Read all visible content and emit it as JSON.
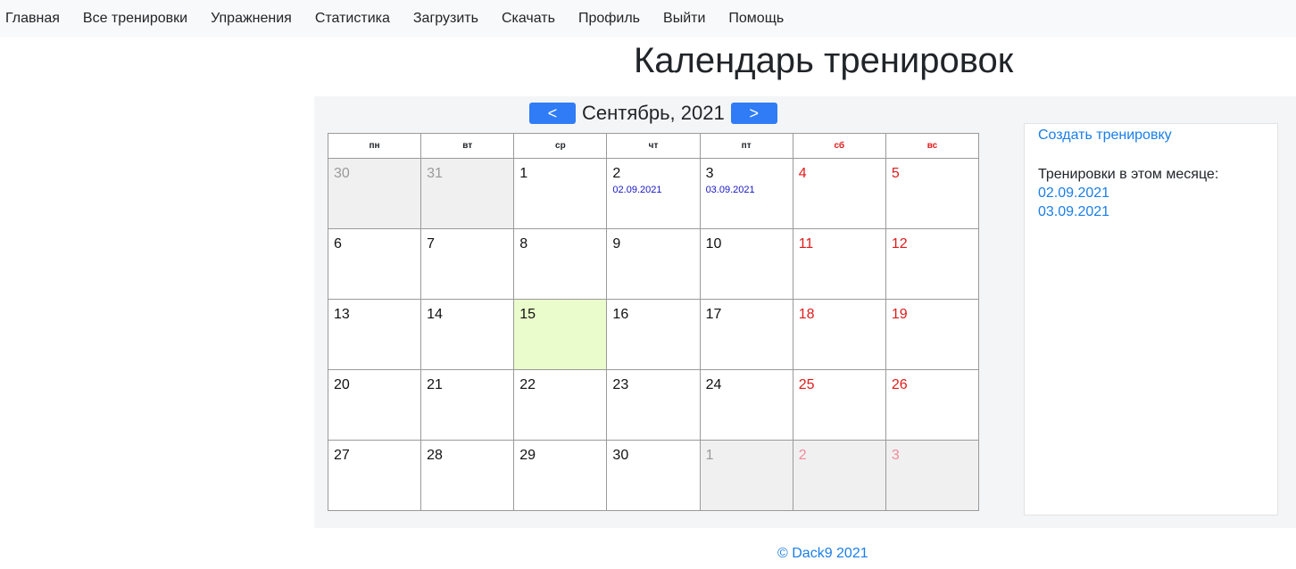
{
  "nav": [
    "Главная",
    "Все тренировки",
    "Упражнения",
    "Статистика",
    "Загрузить",
    "Скачать",
    "Профиль",
    "Выйти",
    "Помощь"
  ],
  "title": "Календарь тренировок",
  "calendar": {
    "prev_label": "<",
    "next_label": ">",
    "month_label": "Сентябрь, 2021",
    "weekdays": [
      "пн",
      "вт",
      "ср",
      "чт",
      "пт",
      "сб",
      "вс"
    ],
    "weeks": [
      [
        {
          "day": "30",
          "other": true
        },
        {
          "day": "31",
          "other": true
        },
        {
          "day": "1"
        },
        {
          "day": "2",
          "workout": "02.09.2021"
        },
        {
          "day": "3",
          "workout": "03.09.2021"
        },
        {
          "day": "4"
        },
        {
          "day": "5"
        }
      ],
      [
        {
          "day": "6"
        },
        {
          "day": "7"
        },
        {
          "day": "8"
        },
        {
          "day": "9"
        },
        {
          "day": "10"
        },
        {
          "day": "11"
        },
        {
          "day": "12"
        }
      ],
      [
        {
          "day": "13"
        },
        {
          "day": "14"
        },
        {
          "day": "15",
          "today": true
        },
        {
          "day": "16"
        },
        {
          "day": "17"
        },
        {
          "day": "18"
        },
        {
          "day": "19"
        }
      ],
      [
        {
          "day": "20"
        },
        {
          "day": "21"
        },
        {
          "day": "22"
        },
        {
          "day": "23"
        },
        {
          "day": "24"
        },
        {
          "day": "25"
        },
        {
          "day": "26"
        }
      ],
      [
        {
          "day": "27"
        },
        {
          "day": "28"
        },
        {
          "day": "29"
        },
        {
          "day": "30"
        },
        {
          "day": "1",
          "other": true
        },
        {
          "day": "2",
          "other": true
        },
        {
          "day": "3",
          "other": true
        }
      ]
    ]
  },
  "sidebar": {
    "create_label": "Создать тренировку",
    "month_heading": "Тренировки в этом месяце:",
    "workouts": [
      "02.09.2021",
      "03.09.2021"
    ]
  },
  "footer": "© Dack9 2021",
  "colors": {
    "accent": "#2f7cf6",
    "link": "#1a7ee8",
    "weekend": "#e01b1b",
    "today_bg": "#eafccb"
  }
}
